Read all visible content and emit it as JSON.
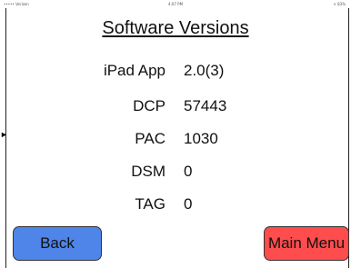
{
  "status_bar": {
    "carrier": "••••• Verizon",
    "time": "4:07 PM",
    "battery": "✳ 83%"
  },
  "title": "Software Versions",
  "versions": [
    {
      "label": "iPad App",
      "value": "2.0(3)"
    },
    {
      "label": "DCP",
      "value": "57443"
    },
    {
      "label": "PAC",
      "value": "1030"
    },
    {
      "label": "DSM",
      "value": "0"
    },
    {
      "label": "TAG",
      "value": "0"
    }
  ],
  "buttons": {
    "back": "Back",
    "main_menu": "Main Menu"
  },
  "colors": {
    "back_button": "#4f84e8",
    "main_menu_button": "#ff4c4c"
  }
}
